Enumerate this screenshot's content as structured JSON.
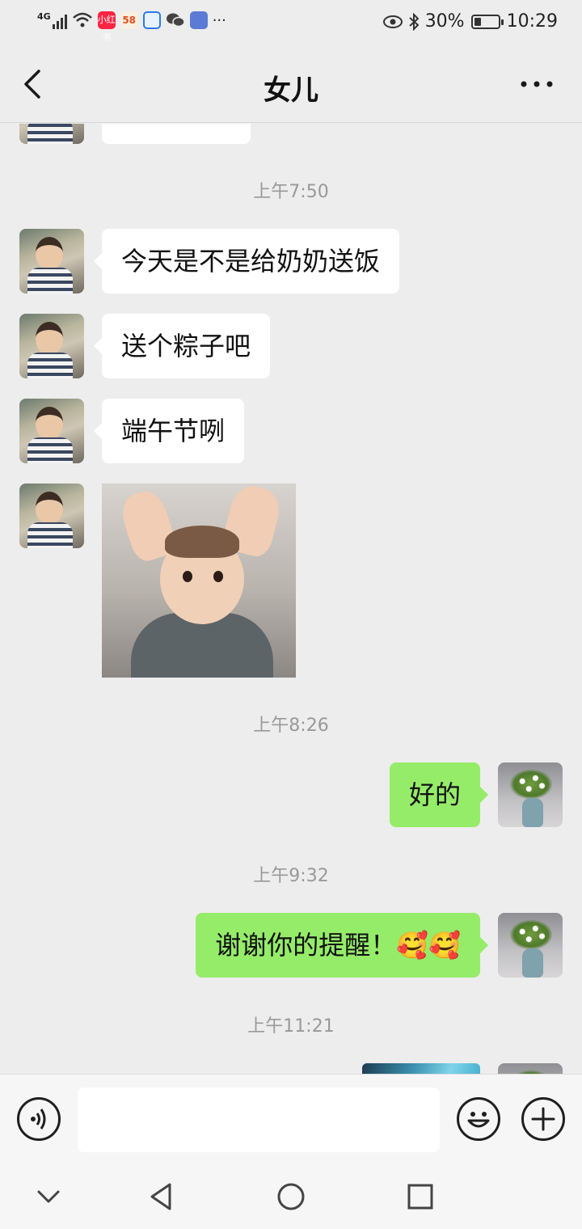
{
  "status_bar": {
    "network": "4G",
    "app_icon_1": "小红书",
    "app_icon_2": "58",
    "more": "···",
    "battery": "30%",
    "battery_level": 0.3,
    "time": "10:29"
  },
  "header": {
    "title": "女儿"
  },
  "messages": [
    {
      "type": "time",
      "text": "上午7:50"
    },
    {
      "type": "text",
      "side": "in",
      "text": "今天是不是给奶奶送饭"
    },
    {
      "type": "text",
      "side": "in",
      "text": "送个粽子吧"
    },
    {
      "type": "text",
      "side": "in",
      "text": "端午节咧"
    },
    {
      "type": "sticker",
      "side": "in",
      "icon": "baby-sticker"
    },
    {
      "type": "time",
      "text": "上午8:26"
    },
    {
      "type": "text",
      "side": "out",
      "text": "好的"
    },
    {
      "type": "time",
      "text": "上午9:32"
    },
    {
      "type": "text",
      "side": "out",
      "text": "谢谢你的提醒！🥰🥰"
    },
    {
      "type": "time",
      "text": "上午11:21"
    },
    {
      "type": "image",
      "side": "out",
      "icon": "image-thumbnail"
    }
  ],
  "input": {
    "value": "",
    "voice_icon": "voice-icon",
    "emoji_icon": "emoji-icon",
    "plus_icon": "plus-icon"
  },
  "navbar": {
    "icons": [
      "chevron-down-icon",
      "back-triangle-icon",
      "home-circle-icon",
      "recent-square-icon"
    ]
  }
}
